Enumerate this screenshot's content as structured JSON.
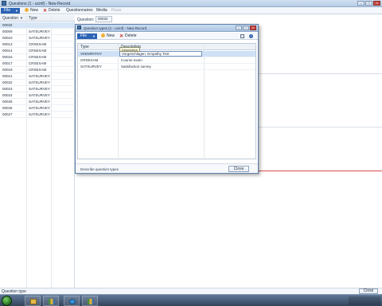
{
  "window": {
    "title": "Questions (1 - ucmf) - New Record",
    "controls": [
      "min",
      "max",
      "close"
    ]
  },
  "actionpane": {
    "file_label": "File",
    "new_label": "New",
    "delete_label": "Delete",
    "questionnaires_label": "Questionnaires",
    "media_label": "Media",
    "rows_label": "Rows"
  },
  "questions_list": {
    "col_question": "Question",
    "col_type": "Type",
    "rows": [
      {
        "question": "00032",
        "type": ""
      },
      {
        "question": "00009",
        "type": "SATSURVEY"
      },
      {
        "question": "00010",
        "type": "SATSURVEY"
      },
      {
        "question": "00013",
        "type": "CRSEXAM"
      },
      {
        "question": "00014",
        "type": "CRSEXAM"
      },
      {
        "question": "00016",
        "type": "CRSEXAM"
      },
      {
        "question": "00017",
        "type": "CRSEXAM"
      },
      {
        "question": "00019",
        "type": "CRSEXAM"
      },
      {
        "question": "00021",
        "type": "SATSURVEY"
      },
      {
        "question": "00022",
        "type": "SATSURVEY"
      },
      {
        "question": "00023",
        "type": "SATSURVEY"
      },
      {
        "question": "00024",
        "type": "SATSURVEY"
      },
      {
        "question": "00025",
        "type": "SATSURVEY"
      },
      {
        "question": "00026",
        "type": "SATSURVEY"
      },
      {
        "question": "00027",
        "type": "SATSURVEY"
      }
    ]
  },
  "detail": {
    "question_label": "Question:",
    "question_value": "00032"
  },
  "dialog": {
    "title": "Question types (1 - ucmf) - New Record",
    "file_label": "File",
    "new_label": "New",
    "delete_label": "Delete",
    "help_label": "?",
    "col_type": "Type",
    "col_description": "Description",
    "tooltip": "Description",
    "rows": [
      {
        "type": "VKEMPATHY",
        "description": "Vorgeschlagen: Empathy Test"
      },
      {
        "type": "CRSEXAM",
        "description": "Course exam"
      },
      {
        "type": "SATSURVEY",
        "description": "Satisfaction survey"
      }
    ],
    "status_text": "Describe question types",
    "close_label": "Close"
  },
  "statusbar": {
    "text": "Question type",
    "close_label": "Close"
  },
  "taskbar": {
    "tray_text": ""
  }
}
